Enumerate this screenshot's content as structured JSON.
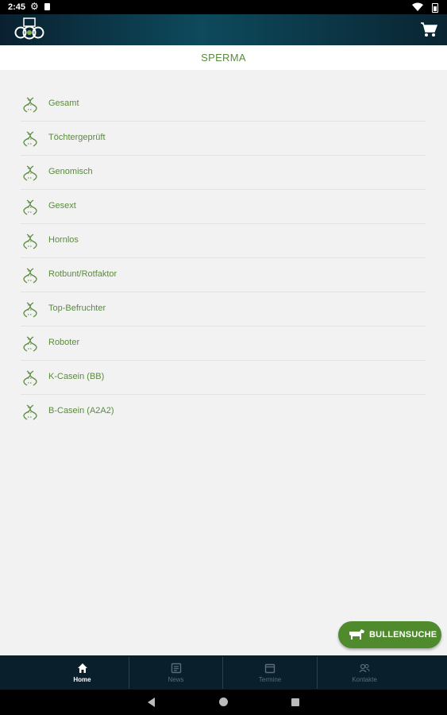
{
  "status_bar": {
    "time": "2:45"
  },
  "header": {
    "title": "SPERMA"
  },
  "categories": [
    {
      "label": "Gesamt"
    },
    {
      "label": "Töchtergeprüft"
    },
    {
      "label": "Genomisch"
    },
    {
      "label": "Gesext"
    },
    {
      "label": "Hornlos"
    },
    {
      "label": "Rotbunt/Rotfaktor"
    },
    {
      "label": "Top-Befruchter"
    },
    {
      "label": "Roboter"
    },
    {
      "label": "K-Casein (BB)"
    },
    {
      "label": "B-Casein (A2A2)"
    }
  ],
  "fab": {
    "label": "BULLENSUCHE"
  },
  "bottom_nav": [
    {
      "label": "Home",
      "icon": "home-icon",
      "active": true
    },
    {
      "label": "News",
      "icon": "news-icon",
      "active": false
    },
    {
      "label": "Termine",
      "icon": "calendar-icon",
      "active": false
    },
    {
      "label": "Kontakte",
      "icon": "contacts-icon",
      "active": false
    }
  ],
  "colors": {
    "accent_green": "#5a8b3d",
    "fab_green": "#4f8a2c",
    "appbar_teal": "#0d4a5c",
    "bottom_nav_bg": "#091f2c"
  }
}
